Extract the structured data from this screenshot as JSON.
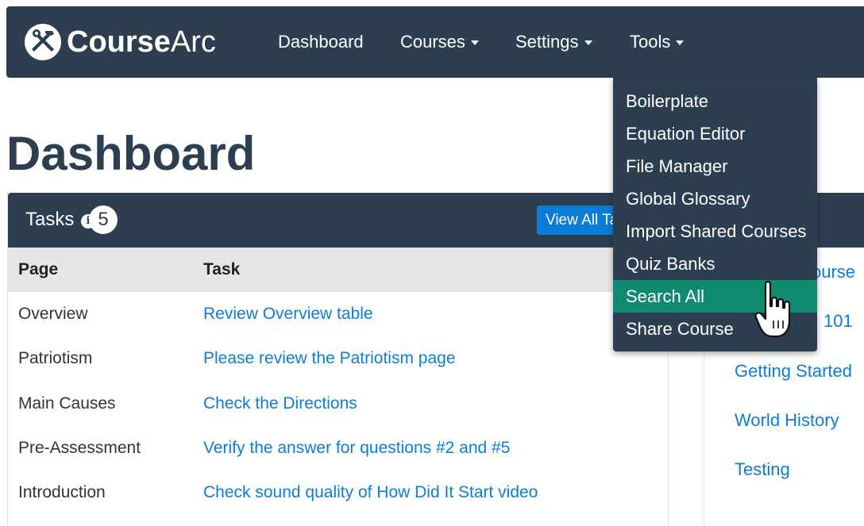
{
  "brand": {
    "bold": "Course",
    "light": "Arc"
  },
  "nav": {
    "dashboard": "Dashboard",
    "courses": "Courses",
    "settings": "Settings",
    "tools": "Tools"
  },
  "page": {
    "title": "Dashboard"
  },
  "tasks": {
    "title": "Tasks",
    "info_symbol": "i",
    "count": "5",
    "view_all_label": "View All Tasks",
    "columns": {
      "page": "Page",
      "task": "Task"
    },
    "rows": [
      {
        "page": "Overview",
        "task": "Review Overview table"
      },
      {
        "page": "Patriotism",
        "task": "Please review the Patriotism page"
      },
      {
        "page": "Main Causes",
        "task": "Check the Directions"
      },
      {
        "page": "Pre-Assessment",
        "task": "Verify the answer for questions #2 and #5"
      },
      {
        "page": "Introduction",
        "task": "Check sound quality of How Did It Start video"
      }
    ]
  },
  "courses_panel": {
    "partial_header": "ourse",
    "partial_course": "101",
    "links": [
      "Getting Started",
      "World History",
      "Testing"
    ]
  },
  "tools_menu": {
    "items": [
      "Boilerplate",
      "Equation Editor",
      "File Manager",
      "Global Glossary",
      "Import Shared Courses",
      "Quiz Banks",
      "Search All",
      "Share Course"
    ],
    "active": "Search All"
  },
  "colors": {
    "navbar": "#2d3e50",
    "link": "#0b7dd8",
    "active_menu": "#118a72",
    "table_header": "#e6e6e6"
  },
  "icons": {
    "logo": "wrench-hammer-logo-icon",
    "info": "info-icon",
    "cursor": "hand-pointer-cursor-icon"
  }
}
